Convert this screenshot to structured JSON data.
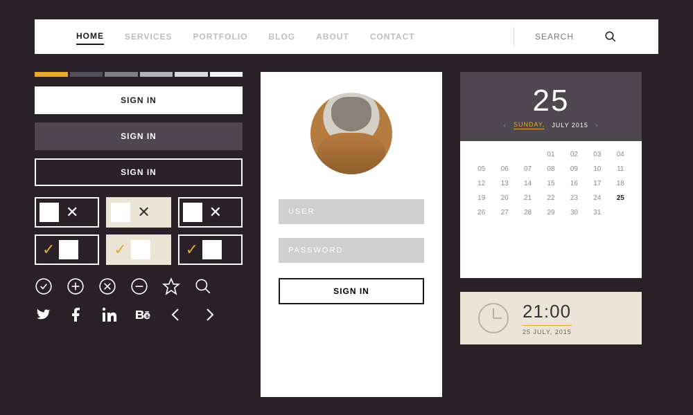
{
  "nav": {
    "items": [
      "HOME",
      "SERVICES",
      "PORTFOLIO",
      "BLOG",
      "ABOUT",
      "CONTACT"
    ],
    "active_index": 0,
    "search_placeholder": "SEARCH"
  },
  "buttons": {
    "white": "SIGN IN",
    "grey": "SIGN IN",
    "outline": "SIGN IN"
  },
  "login": {
    "user_placeholder": "USER",
    "password_placeholder": "PASSWORD",
    "submit_label": "SIGN IN"
  },
  "calendar": {
    "day_number": "25",
    "weekday": "SUNDAY,",
    "month_year": "JULY 2015",
    "days": [
      "",
      "",
      "",
      "01",
      "02",
      "03",
      "04",
      "05",
      "06",
      "07",
      "08",
      "09",
      "10",
      "11",
      "12",
      "13",
      "14",
      "15",
      "16",
      "17",
      "18",
      "19",
      "20",
      "21",
      "22",
      "23",
      "24",
      "25",
      "26",
      "27",
      "28",
      "29",
      "30",
      "31"
    ],
    "today": "25"
  },
  "clock": {
    "time": "21:00",
    "date": "25 JULY, 2015"
  },
  "colors": {
    "accent": "#e5a92e",
    "bg": "#2a2128",
    "panel": "#4e4750",
    "cream": "#ece4d7"
  }
}
